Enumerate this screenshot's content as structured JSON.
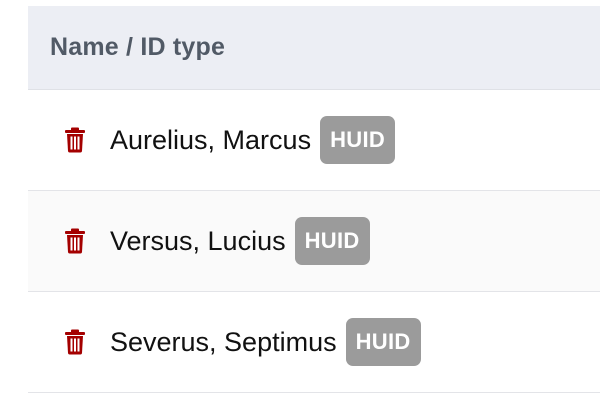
{
  "table": {
    "header": {
      "name_column_label": "Name / ID type"
    },
    "rows": [
      {
        "name": "Aurelius, Marcus",
        "id_type": "HUID",
        "delete_icon": "trash-icon"
      },
      {
        "name": "Versus, Lucius",
        "id_type": "HUID",
        "delete_icon": "trash-icon"
      },
      {
        "name": "Severus, Septimus",
        "id_type": "HUID",
        "delete_icon": "trash-icon"
      }
    ]
  },
  "colors": {
    "header_background": "#eceef4",
    "header_text": "#515a66",
    "delete_icon": "#a40000",
    "badge_background": "#9b9b9b",
    "badge_text": "#ffffff"
  }
}
